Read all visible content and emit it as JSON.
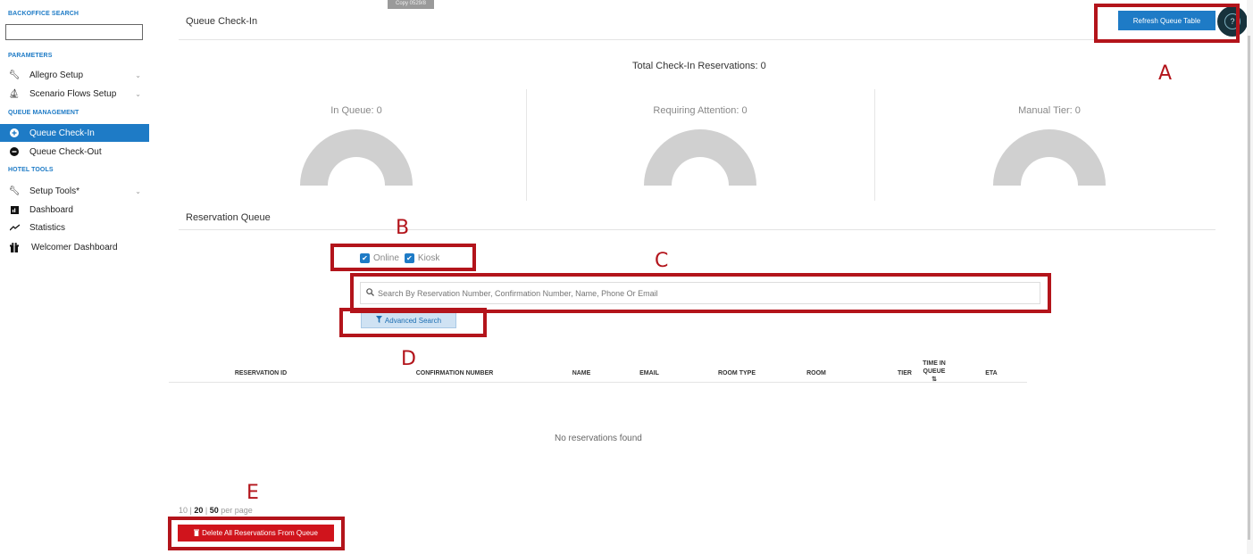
{
  "sidebar": {
    "search_title": "BACKOFFICE SEARCH",
    "search_placeholder": "",
    "parameters_title": "PARAMETERS",
    "queue_management_title": "QUEUE MANAGEMENT",
    "hotel_tools_title": "HOTEL TOOLS",
    "items": [
      {
        "label": "Allegro Setup",
        "icon": "wrench-icon",
        "chevron": "⌄"
      },
      {
        "label": "Scenario Flows Setup",
        "icon": "flow-icon",
        "chevron": "⌄"
      },
      {
        "label": "Queue Check-In",
        "icon": "plus-circle-icon",
        "active": true
      },
      {
        "label": "Queue Check-Out",
        "icon": "minus-circle-icon"
      },
      {
        "label": "Setup Tools*",
        "icon": "wrench-icon",
        "chevron": "⌄"
      },
      {
        "label": "Dashboard",
        "icon": "dashboard-icon"
      },
      {
        "label": "Statistics",
        "icon": "trend-icon"
      },
      {
        "label": "Welcomer Dashboard",
        "icon": "gift-icon"
      }
    ]
  },
  "header": {
    "copy_tag": "Copy 0529/8",
    "title": "Queue Check-In",
    "refresh_label": "Refresh Queue Table",
    "help_label": "?"
  },
  "summary": {
    "total_label": "Total Check-In Reservations:  0",
    "gauges": [
      {
        "label": "In Queue:  0",
        "value": 0
      },
      {
        "label": "Requiring Attention:  0",
        "value": 0
      },
      {
        "label": "Manual Tier:  0",
        "value": 0
      }
    ]
  },
  "queue": {
    "title": "Reservation Queue",
    "filters": [
      {
        "label": "Online",
        "checked": true
      },
      {
        "label": "Kiosk",
        "checked": true
      }
    ],
    "search_placeholder": "Search By Reservation Number, Confirmation Number, Name, Phone Or Email",
    "advanced_search_label": "Advanced Search",
    "columns": [
      "RESERVATION ID",
      "CONFIRMATION NUMBER",
      "NAME",
      "EMAIL",
      "ROOM TYPE",
      "ROOM",
      "TIER",
      "TIME IN QUEUE",
      "ETA"
    ],
    "sort_icon": "⇅",
    "empty_message": "No reservations found",
    "per_page_options": [
      "10",
      "20",
      "50"
    ],
    "per_page_suffix": "per page",
    "delete_all_label": "Delete All Reservations From Queue"
  },
  "annotations": [
    "A",
    "B",
    "C",
    "D",
    "E"
  ],
  "colors": {
    "accent": "#1e7bc6",
    "danger": "#d0141c",
    "annotation": "#b3141b",
    "gauge": "#d0d0d0"
  }
}
